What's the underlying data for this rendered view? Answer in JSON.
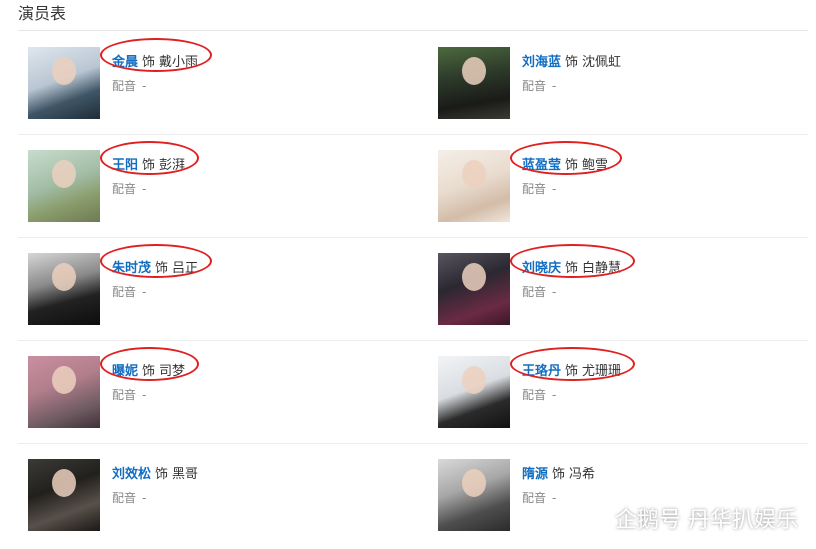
{
  "page": {
    "title": "演员表"
  },
  "cast": [
    {
      "actor": "金晨",
      "as": "饰",
      "role": "戴小雨",
      "dub_label": "配音",
      "dub_value": "-",
      "highlighted": true
    },
    {
      "actor": "刘海蓝",
      "as": "饰",
      "role": "沈佩虹",
      "dub_label": "配音",
      "dub_value": "-",
      "highlighted": false
    },
    {
      "actor": "王阳",
      "as": "饰",
      "role": "彭湃",
      "dub_label": "配音",
      "dub_value": "-",
      "highlighted": true
    },
    {
      "actor": "蓝盈莹",
      "as": "饰",
      "role": "鲍雪",
      "dub_label": "配音",
      "dub_value": "-",
      "highlighted": true
    },
    {
      "actor": "朱时茂",
      "as": "饰",
      "role": "吕正",
      "dub_label": "配音",
      "dub_value": "-",
      "highlighted": true
    },
    {
      "actor": "刘晓庆",
      "as": "饰",
      "role": "白静慧",
      "dub_label": "配音",
      "dub_value": "-",
      "highlighted": true
    },
    {
      "actor": "曝妮",
      "as": "饰",
      "role": "司梦",
      "dub_label": "配音",
      "dub_value": "-",
      "highlighted": true
    },
    {
      "actor": "王珞丹",
      "as": "饰",
      "role": "尤珊珊",
      "dub_label": "配音",
      "dub_value": "-",
      "highlighted": true
    },
    {
      "actor": "刘效松",
      "as": "饰",
      "role": "黑哥",
      "dub_label": "配音",
      "dub_value": "-",
      "highlighted": false
    },
    {
      "actor": "隋源",
      "as": "饰",
      "role": "冯希",
      "dub_label": "配音",
      "dub_value": "-",
      "highlighted": false
    }
  ],
  "watermark": {
    "text": "企鹅号 丹华扒娱乐",
    "icon": "penguin-logo-icon"
  },
  "colors": {
    "actor_link": "#136ec2",
    "annotation": "#e02020",
    "separator": "#ececec"
  }
}
